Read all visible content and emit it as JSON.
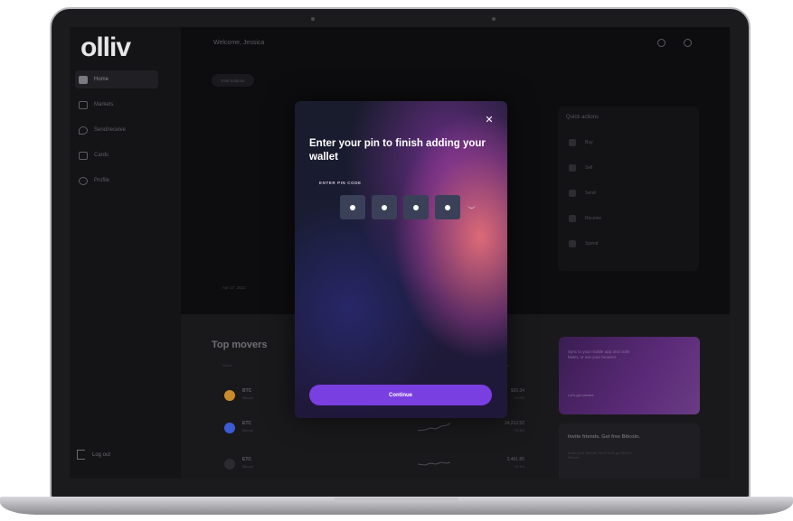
{
  "sidebar": {
    "logo": "olliv",
    "items": [
      {
        "label": "Home"
      },
      {
        "label": "Markets"
      },
      {
        "label": "Send/receive"
      },
      {
        "label": "Cards"
      },
      {
        "label": "Profile"
      }
    ],
    "logout_label": "Log out"
  },
  "header": {
    "welcome": "Welcome, Jessica"
  },
  "hero": {
    "balance_pill": "Total balance",
    "date": "Apr 27, 2022"
  },
  "quick_actions": {
    "title": "Quick actions",
    "items": [
      {
        "label": "Buy"
      },
      {
        "label": "Sell"
      },
      {
        "label": "Send"
      },
      {
        "label": "Receive"
      },
      {
        "label": "Spend"
      }
    ]
  },
  "movers": {
    "title": "Top movers",
    "col_name": "Name",
    "col_price": "Price",
    "rows": [
      {
        "symbol": "BTC",
        "name": "Bitcoin",
        "price": "$30.34",
        "change": "+0.2%",
        "color": "#c98a2a"
      },
      {
        "symbol": "ETC",
        "name": "Bitcoin",
        "price": "14,212.52",
        "change": "+0.3%",
        "color": "#3b5bd6"
      },
      {
        "symbol": "ETC",
        "name": "Bitcoin",
        "price": "3,461.85",
        "change": "+0.1%",
        "color": "#2c2c30"
      }
    ]
  },
  "promo": {
    "card1_text": "Sync to your mobile app and order faster, or use your browser.",
    "card1_link": "Let's get started",
    "card2_title": "Invite friends. Get free Bitcoin.",
    "card2_text": "Invite your friends. You'll both get $10 in Bitcoin."
  },
  "modal": {
    "title": "Enter your pin to finish adding your wallet",
    "pin_label": "ENTER PIN CODE",
    "pin_digits": 4,
    "continue_label": "Continue",
    "accent": "#7a3fe0"
  }
}
